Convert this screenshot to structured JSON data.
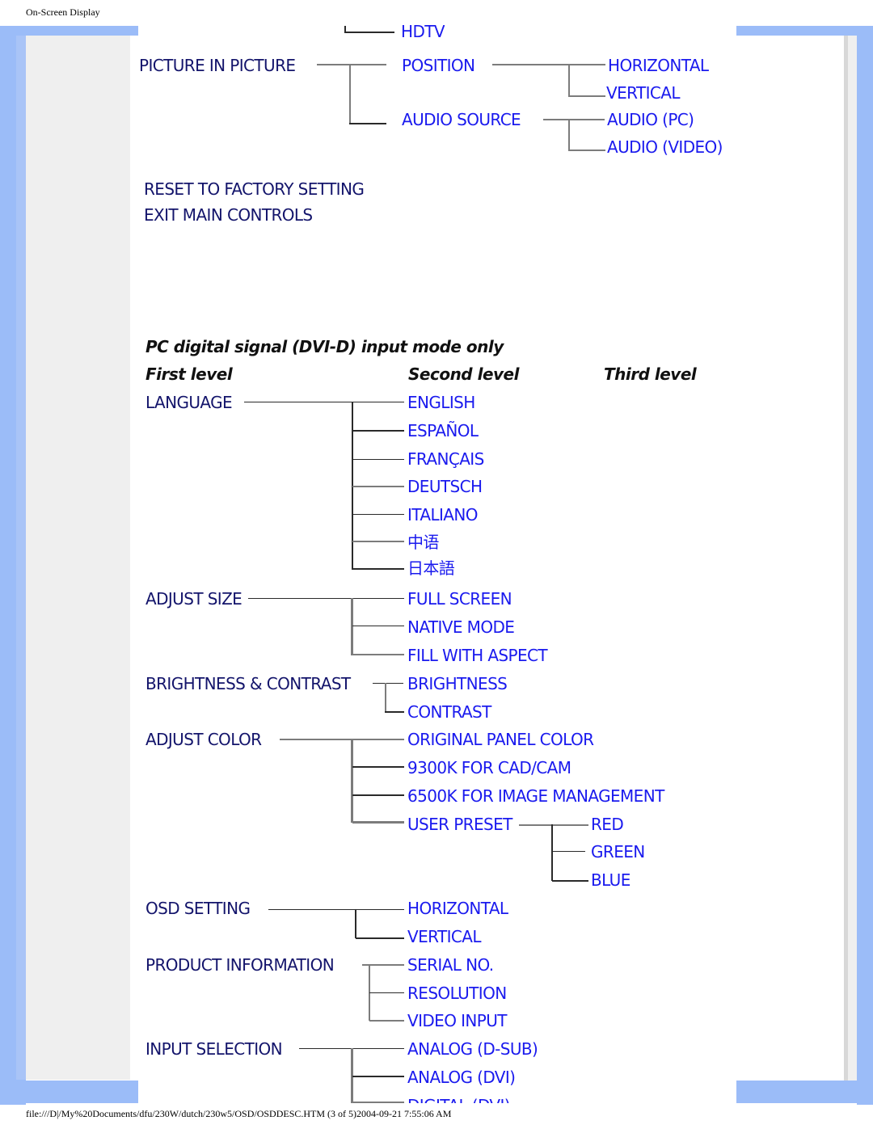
{
  "page": {
    "header_title": "On-Screen Display",
    "footer_path": "file:///D|/My%20Documents/dfu/230W/dutch/230w5/OSD/OSDDESC.HTM (3 of 5)2004-09-21 7:55:06 AM"
  },
  "colors": {
    "frame_blue": "#9bbcf8",
    "first_level_text": "#13146b",
    "second_level_text": "#1a1aee",
    "panel_grey": "#efefef"
  },
  "top_section": {
    "hdtv": "HDTV",
    "pip": {
      "label": "PICTURE IN PICTURE",
      "children": [
        {
          "label": "POSITION",
          "children": [
            "HORIZONTAL",
            "VERTICAL"
          ]
        },
        {
          "label": "AUDIO SOURCE",
          "children": [
            "AUDIO (PC)",
            "AUDIO (VIDEO)"
          ]
        }
      ]
    },
    "reset": "RESET TO FACTORY SETTING",
    "exit": "EXIT MAIN CONTROLS"
  },
  "dvi_section": {
    "title": "PC digital signal (DVI-D) input mode only",
    "col_headers": [
      "First level",
      "Second level",
      "Third level"
    ],
    "groups": [
      {
        "label": "LANGUAGE",
        "children": [
          "ENGLISH",
          "ESPAÑOL",
          "FRANÇAIS",
          "DEUTSCH",
          "ITALIANO",
          "中语",
          "日本語"
        ]
      },
      {
        "label": "ADJUST SIZE",
        "children": [
          "FULL SCREEN",
          "NATIVE MODE",
          "FILL WITH ASPECT"
        ]
      },
      {
        "label": "BRIGHTNESS & CONTRAST",
        "children": [
          "BRIGHTNESS",
          "CONTRAST"
        ]
      },
      {
        "label": "ADJUST COLOR",
        "children": [
          "ORIGINAL PANEL COLOR",
          "9300K FOR CAD/CAM",
          "6500K FOR IMAGE MANAGEMENT",
          "USER PRESET"
        ],
        "user_preset_children": [
          "RED",
          "GREEN",
          "BLUE"
        ]
      },
      {
        "label": "OSD SETTING",
        "children": [
          "HORIZONTAL",
          "VERTICAL"
        ]
      },
      {
        "label": "PRODUCT INFORMATION",
        "children": [
          "SERIAL NO.",
          "RESOLUTION",
          "VIDEO INPUT"
        ]
      },
      {
        "label": "INPUT SELECTION",
        "children": [
          "ANALOG (D-SUB)",
          "ANALOG (DVI)",
          "DIGITAL (DVI)"
        ]
      }
    ]
  }
}
